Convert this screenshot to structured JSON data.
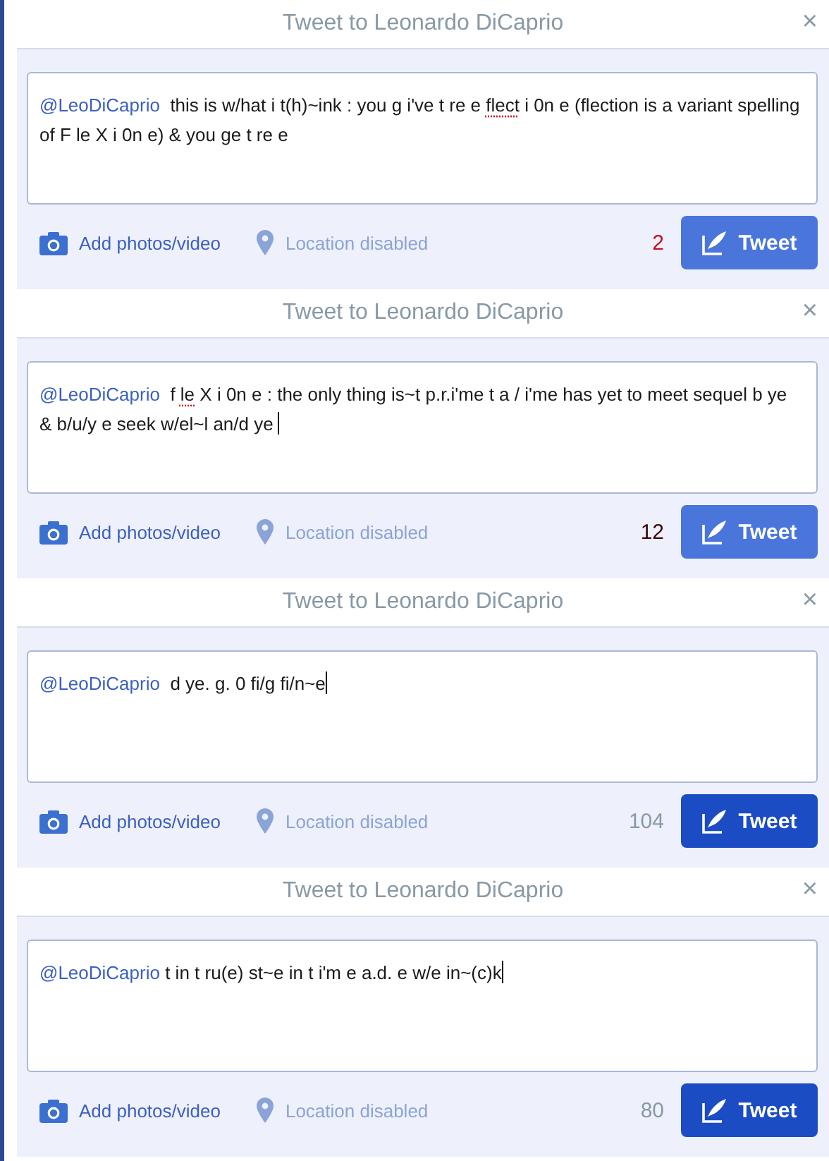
{
  "dialogs": [
    {
      "title": "Tweet to Leonardo DiCaprio",
      "close": "×",
      "lines": [
        [
          {
            "kind": "mention",
            "text": "@LeoDiCaprio"
          },
          {
            "kind": "text",
            "text": "  this is w/hat i t(h)~ink : you g i've t re e "
          },
          {
            "kind": "misspelled",
            "text": "flect"
          },
          {
            "kind": "text",
            "text": " i 0n e (flection is a variant spelling"
          }
        ],
        [
          {
            "kind": "text",
            "text": "of F le X i 0n e) & you ge t re e"
          }
        ]
      ],
      "cursor": false,
      "photo_label": "Add photos/video",
      "location_label": "Location disabled",
      "counter": {
        "text": "2",
        "color": "#c4121f"
      },
      "button_label": "Tweet",
      "button_pressed": false
    },
    {
      "title": "Tweet to Leonardo DiCaprio",
      "close": "×",
      "lines": [
        [
          {
            "kind": "mention",
            "text": "@LeoDiCaprio"
          },
          {
            "kind": "text",
            "text": "  f "
          },
          {
            "kind": "misspelled",
            "text": "le"
          },
          {
            "kind": "text",
            "text": " X i 0n e : the only thing is~t p.r.i'me t a / i'me has yet to meet sequel b ye"
          }
        ],
        [
          {
            "kind": "text",
            "text": "& b/u/y e seek w/el~l an/d ye "
          }
        ]
      ],
      "cursor": true,
      "photo_label": "Add photos/video",
      "location_label": "Location disabled",
      "counter": {
        "text": "12",
        "color": "#3a0a0a"
      },
      "button_label": "Tweet",
      "button_pressed": false
    },
    {
      "title": "Tweet to Leonardo DiCaprio",
      "close": "×",
      "lines": [
        [
          {
            "kind": "mention",
            "text": "@LeoDiCaprio"
          },
          {
            "kind": "text",
            "text": "  d ye. g. 0 fi/g fi/n~e"
          }
        ]
      ],
      "cursor": true,
      "photo_label": "Add photos/video",
      "location_label": "Location disabled",
      "counter": {
        "text": "104",
        "color": "#8899a6"
      },
      "button_label": "Tweet",
      "button_pressed": true
    },
    {
      "title": "Tweet to Leonardo DiCaprio",
      "close": "×",
      "lines": [
        [
          {
            "kind": "mention",
            "text": "@LeoDiCaprio"
          },
          {
            "kind": "text",
            "text": " t in t ru(e) st~e in t i'm e a.d. e w/e in~(c)k"
          }
        ]
      ],
      "cursor": true,
      "photo_label": "Add photos/video",
      "location_label": "Location disabled",
      "counter": {
        "text": "80",
        "color": "#8899a6"
      },
      "button_label": "Tweet",
      "button_pressed": true
    }
  ]
}
